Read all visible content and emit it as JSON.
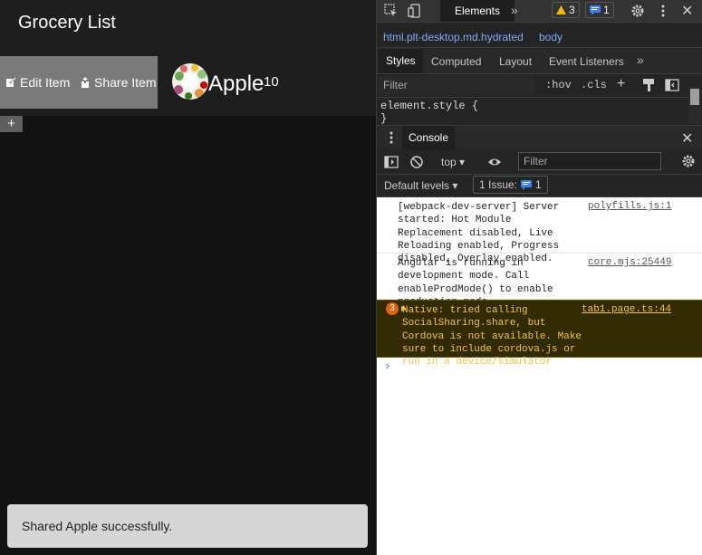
{
  "app": {
    "title": "Grocery List",
    "edit_label": "Edit Item",
    "share_label": "Share Item",
    "item_name": "Apple",
    "item_quantity": "10",
    "add_label": "+",
    "toast": "Shared Apple successfully."
  },
  "devtools": {
    "main_tab": "Elements",
    "more": "»",
    "warnings_count": "3",
    "messages_count": "1",
    "breadcrumbs": [
      "html.plt-desktop.md.hydrated",
      "body"
    ],
    "style_tabs": [
      "Styles",
      "Computed",
      "Layout",
      "Event Listeners"
    ],
    "styles_filter_placeholder": "Filter",
    "hov": ":hov",
    "cls": ".cls",
    "element_style_line1": "element.style {",
    "element_style_line2": "}",
    "drawer_tab": "Console",
    "context": "top",
    "console_filter_placeholder": "Filter",
    "levels": "Default levels",
    "issues_label": "1 Issue:",
    "issues_count": "1",
    "messages": [
      {
        "text": "[webpack-dev-server] Server started: Hot Module Replacement disabled, Live Reloading enabled, Progress disabled, Overlay enabled.",
        "source": "polyfills.js:1"
      },
      {
        "text": "Angular is running in development mode. Call enableProdMode() to enable production mode.",
        "source": "core.mjs:25449"
      },
      {
        "text": "Native: tried calling SocialSharing.share, but Cordova is not available. Make sure to include cordova.js or run in a device/simulator",
        "source": "tab1.page.ts:44",
        "count": "3",
        "level": "warning"
      }
    ],
    "prompt": "›"
  },
  "colors": {
    "accent": "#7cacf8",
    "warning_text": "#f5c24c",
    "warning_bg": "#332b00",
    "option_bg": "#7a7a7a",
    "issue_icon": "#3a7ef0"
  }
}
